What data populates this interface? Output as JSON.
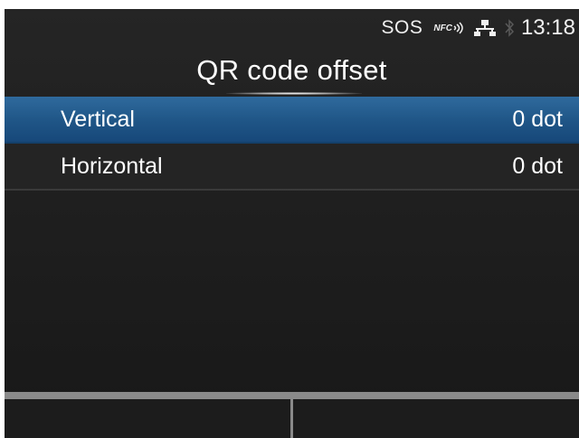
{
  "status_bar": {
    "sos": "SOS",
    "nfc": "NFC",
    "time": "13:18",
    "icons": [
      "nfc-icon",
      "network-icon",
      "bluetooth-icon"
    ]
  },
  "title": "QR code offset",
  "menu": {
    "items": [
      {
        "label": "Vertical",
        "value": "0 dot",
        "selected": true
      },
      {
        "label": "Horizontal",
        "value": "0 dot",
        "selected": false
      }
    ]
  },
  "softkeys": [
    {
      "label": ""
    },
    {
      "label": ""
    }
  ],
  "colors": {
    "background": "#1d1d1d",
    "selection": "#1f5586",
    "text": "#ffffff",
    "softkey_border": "#8a8a8a"
  }
}
